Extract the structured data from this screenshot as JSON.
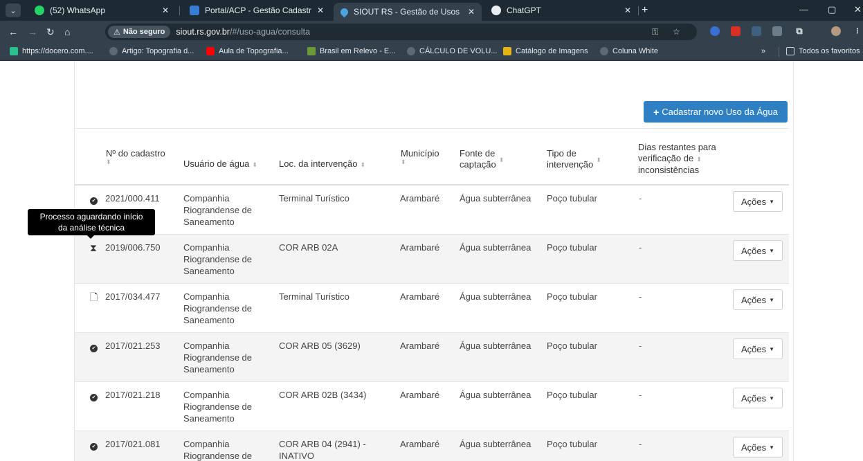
{
  "browser": {
    "tabs": [
      {
        "title": "(52) WhatsApp",
        "favicon": "whatsapp-icon",
        "badge": "52"
      },
      {
        "title": "Portal/ACP - Gestão Cadastral de",
        "favicon": "portal-icon"
      },
      {
        "title": "SIOUT RS - Gestão de Usos da Á",
        "favicon": "water-drop-icon",
        "active": true
      },
      {
        "title": "ChatGPT",
        "favicon": "chatgpt-icon"
      }
    ],
    "security_label": "Não seguro",
    "url_host": "siout.rs.gov.br",
    "url_path": "/#/uso-agua/consulta",
    "bookmarks": [
      "https://docero.com....",
      "Artigo: Topografia d...",
      "Aula de Topografia...",
      "Brasil em Relevo - E...",
      "CÁLCULO DE VOLU...",
      "Catálogo de Imagens",
      "Coluna White"
    ],
    "bookmarks_overflow": "»",
    "all_favorites": "Todos os favoritos"
  },
  "page": {
    "new_button": "Cadastrar novo Uso da Água",
    "columns": {
      "numero": "Nº do cadastro",
      "usuario": "Usuário de água",
      "local": "Loc. da intervenção",
      "municipio": "Município",
      "fonte": "Fonte de captação",
      "fonte_l1": "Fonte de",
      "fonte_l2": "captação",
      "tipo_l1": "Tipo de",
      "tipo_l2": "intervenção",
      "dias_l1": "Dias restantes para",
      "dias_l2": "verificação de",
      "dias_l3": "inconsistências"
    },
    "tooltip_l1": "Processo aguardando início",
    "tooltip_l2": "da análise técnica",
    "actions_label": "Ações",
    "rows": [
      {
        "status": "check-circle-icon",
        "numero": "2021/000.411",
        "usuario_l1": "Companhia",
        "usuario_l2": "Riograndense de",
        "usuario_l3": "Saneamento",
        "local_l1": "Terminal Turístico",
        "local_l2": "",
        "municipio": "Arambaré",
        "fonte": "Água subterrânea",
        "tipo": "Poço tubular",
        "dias": "-"
      },
      {
        "status": "hourglass-icon",
        "numero": "2019/006.750",
        "usuario_l1": "Companhia",
        "usuario_l2": "Riograndense de",
        "usuario_l3": "Saneamento",
        "local_l1": "COR ARB 02A",
        "local_l2": "",
        "municipio": "Arambaré",
        "fonte": "Água subterrânea",
        "tipo": "Poço tubular",
        "dias": "-"
      },
      {
        "status": "document-icon",
        "numero": "2017/034.477",
        "usuario_l1": "Companhia",
        "usuario_l2": "Riograndense de",
        "usuario_l3": "Saneamento",
        "local_l1": "Terminal Turístico",
        "local_l2": "",
        "municipio": "Arambaré",
        "fonte": "Água subterrânea",
        "tipo": "Poço tubular",
        "dias": "-"
      },
      {
        "status": "check-circle-icon",
        "numero": "2017/021.253",
        "usuario_l1": "Companhia",
        "usuario_l2": "Riograndense de",
        "usuario_l3": "Saneamento",
        "local_l1": "COR ARB 05 (3629)",
        "local_l2": "",
        "municipio": "Arambaré",
        "fonte": "Água subterrânea",
        "tipo": "Poço tubular",
        "dias": "-"
      },
      {
        "status": "check-circle-icon",
        "numero": "2017/021.218",
        "usuario_l1": "Companhia",
        "usuario_l2": "Riograndense de",
        "usuario_l3": "Saneamento",
        "local_l1": "COR ARB 02B (3434)",
        "local_l2": "",
        "municipio": "Arambaré",
        "fonte": "Água subterrânea",
        "tipo": "Poço tubular",
        "dias": "-"
      },
      {
        "status": "check-circle-icon",
        "numero": "2017/021.081",
        "usuario_l1": "Companhia",
        "usuario_l2": "Riograndense de",
        "usuario_l3": "",
        "local_l1": "COR ARB 04 (2941) -",
        "local_l2": "INATIVO",
        "municipio": "Arambaré",
        "fonte": "Água subterrânea",
        "tipo": "Poço tubular",
        "dias": "-"
      }
    ]
  },
  "colors": {
    "primary_button": "#2f80c2",
    "chrome_dark": "#1e2a33",
    "chrome_bar": "#33414c",
    "tooltip_bg": "#000000"
  }
}
